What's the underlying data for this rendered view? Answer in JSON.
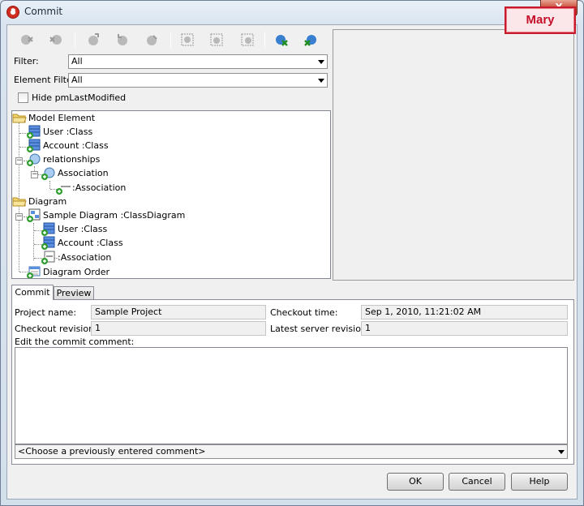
{
  "window": {
    "title": "Commit",
    "close_glyph": "X"
  },
  "user_badge": "Mary",
  "toolbar": {
    "icons": [
      "delete-node-icon",
      "delete-node-icon",
      "add-node-icon",
      "edit-node-icon",
      "move-node-icon",
      "select-node-icon",
      "select-node-icon",
      "select-node-icon",
      "check-all-icon",
      "uncheck-all-icon"
    ]
  },
  "filter": {
    "label": "Filter:",
    "value": "All"
  },
  "element_filter": {
    "label": "Element Filter:",
    "value": "All"
  },
  "hide_modified": {
    "label": "Hide pmLastModified",
    "checked": false
  },
  "tree": {
    "model_element": "Model Element",
    "user_class": "User :Class",
    "account_class": "Account :Class",
    "relationships": "relationships",
    "association": "Association",
    "association_child": ":Association",
    "diagram": "Diagram",
    "sample_diagram": "Sample Diagram :ClassDiagram",
    "diagram_user_class": "User :Class",
    "diagram_account_class": "Account :Class",
    "diagram_association": ":Association",
    "diagram_order": "Diagram Order"
  },
  "tabs": {
    "commit": "Commit",
    "preview": "Preview"
  },
  "details": {
    "project_name_label": "Project name:",
    "project_name": "Sample Project",
    "checkout_time_label": "Checkout time:",
    "checkout_time": "Sep 1, 2010, 11:21:02 AM",
    "checkout_revision_label": "Checkout revision:",
    "checkout_revision": "1",
    "latest_revision_label": "Latest server revision:",
    "latest_revision": "1",
    "comment_label": "Edit the commit comment:",
    "comment_value": "",
    "previous_comment_placeholder": "<Choose a previously entered comment>"
  },
  "buttons": {
    "ok": "OK",
    "cancel": "Cancel",
    "help": "Help"
  },
  "colors": {
    "badge_red": "#c5102a",
    "add_green": "#2f9e2f",
    "class_blue": "#3a6fd0"
  }
}
